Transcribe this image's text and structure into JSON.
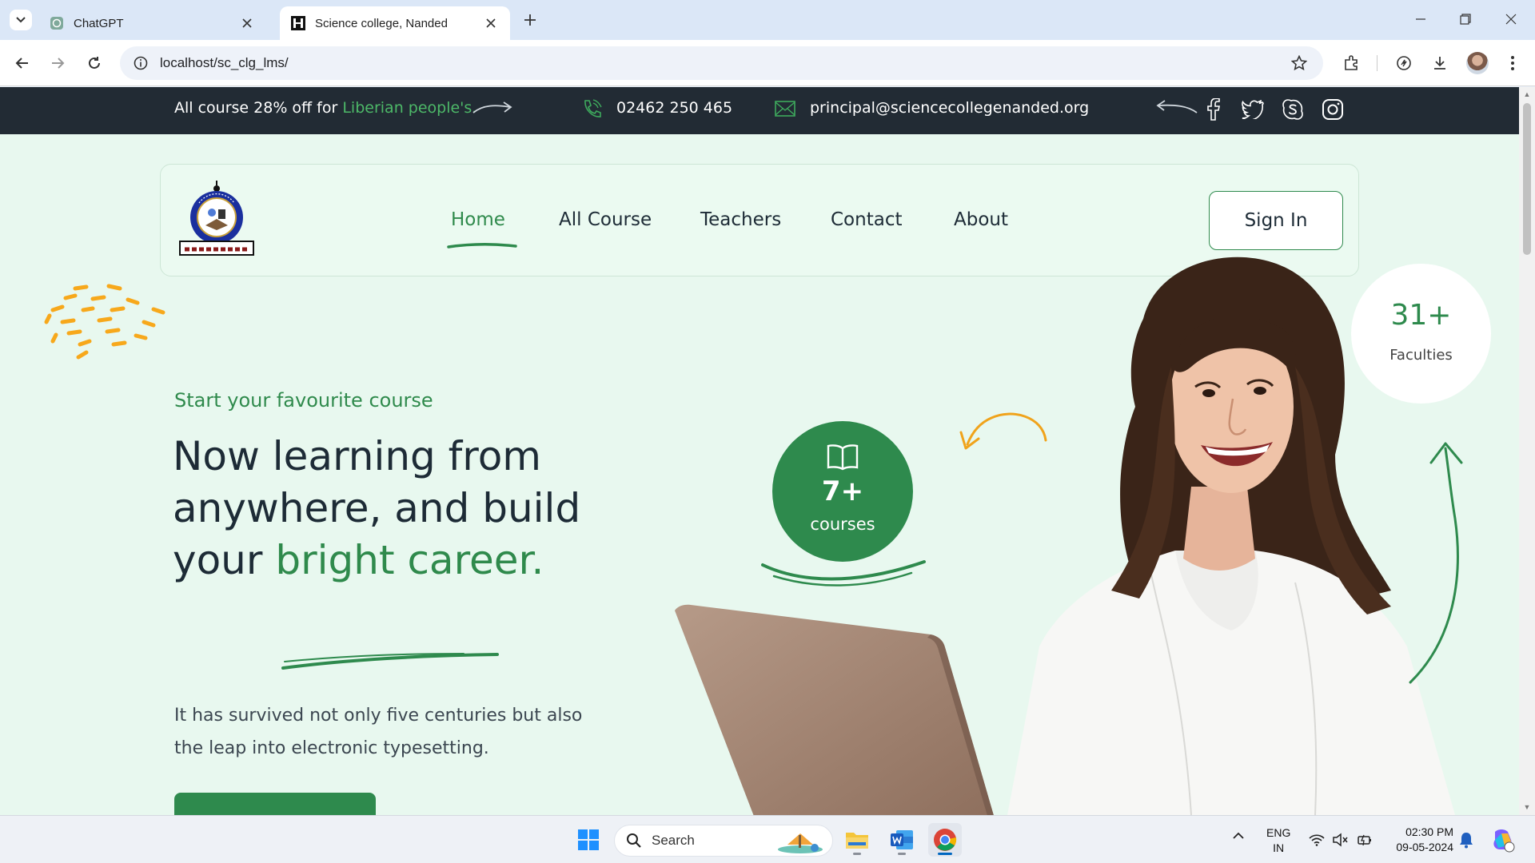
{
  "browser": {
    "tabs": [
      {
        "title": "ChatGPT",
        "active": false,
        "icon": "chatgpt-icon"
      },
      {
        "title": "Science college, Nanded",
        "active": true,
        "icon": "site-favicon"
      }
    ],
    "url": "localhost/sc_clg_lms/"
  },
  "topbar": {
    "offer_text": "All course 28% off for ",
    "offer_highlight": "Liberian people's.",
    "phone": "02462 250 465",
    "email": "principal@sciencecollegenanded.org",
    "social_icons": [
      "facebook-icon",
      "twitter-icon",
      "skype-icon",
      "instagram-icon"
    ]
  },
  "nav": {
    "items": [
      {
        "label": "Home",
        "active": true
      },
      {
        "label": "All Course",
        "active": false
      },
      {
        "label": "Teachers",
        "active": false
      },
      {
        "label": "Contact",
        "active": false
      },
      {
        "label": "About",
        "active": false
      }
    ],
    "signin_label": "Sign In"
  },
  "hero": {
    "eyebrow": "Start your favourite course",
    "headline_main": "Now learning from anywhere, and build your ",
    "headline_highlight": "bright career.",
    "description": "It has survived not only five centuries but also the leap into electronic typesetting.",
    "courses_count": "7+",
    "courses_label": "courses",
    "faculties_count": "31+",
    "faculties_label": "Faculties"
  },
  "taskbar": {
    "search_label": "Search",
    "lang_line1": "ENG",
    "lang_line2": "IN",
    "time": "02:30 PM",
    "date": "09-05-2024"
  },
  "colors": {
    "brand_green": "#2e8a4d",
    "accent_green": "#4db868",
    "dark_bar": "#222b34",
    "page_bg": "#e8f8ef",
    "dash_orange": "#f7a81b"
  }
}
